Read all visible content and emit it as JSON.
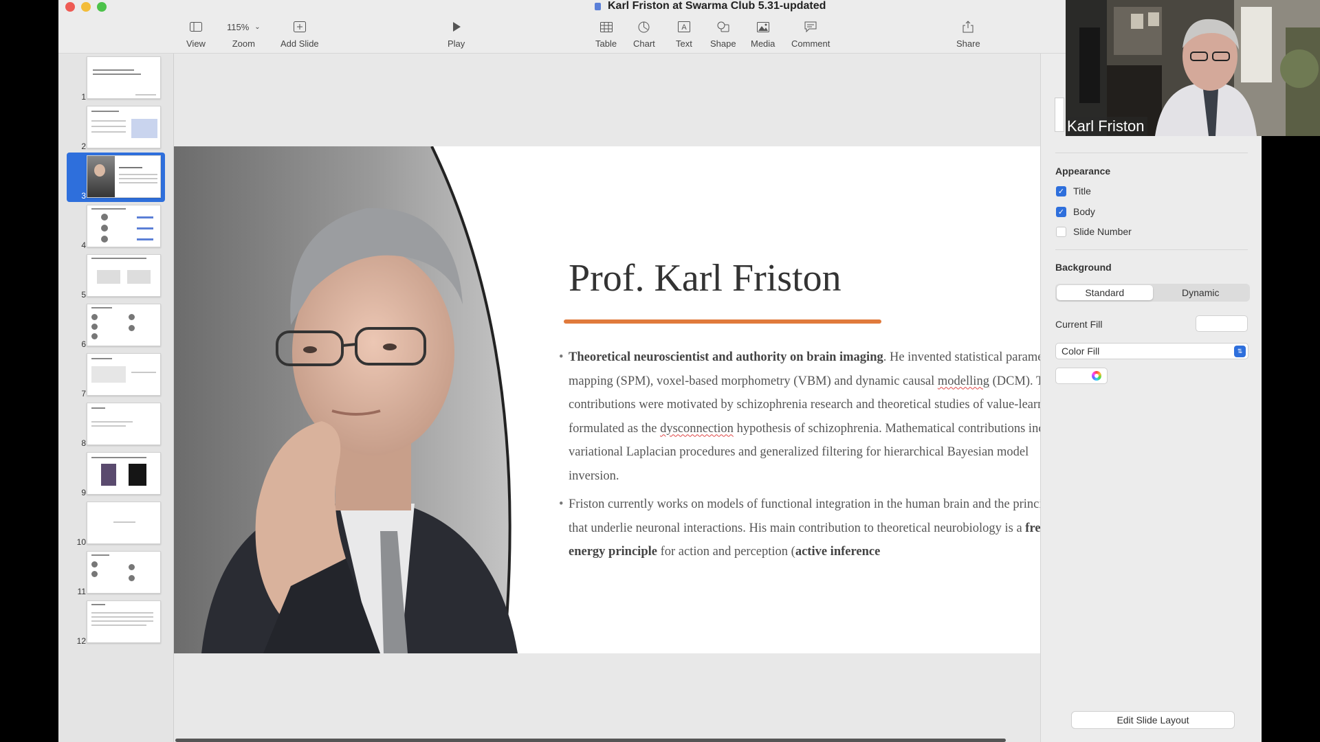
{
  "window": {
    "title": "Karl Friston at Swarma Club 5.31-updated"
  },
  "toolbar": {
    "view_label": "View",
    "zoom_value": "115%",
    "zoom_label": "Zoom",
    "add_slide_label": "Add Slide",
    "play_label": "Play",
    "table_label": "Table",
    "chart_label": "Chart",
    "text_label": "Text",
    "shape_label": "Shape",
    "media_label": "Media",
    "comment_label": "Comment",
    "share_label": "Share"
  },
  "sidebar": {
    "slides": [
      "1",
      "2",
      "3",
      "4",
      "5",
      "6",
      "7",
      "8",
      "9",
      "10",
      "11",
      "12"
    ],
    "selected_slide": "3"
  },
  "slide": {
    "title": "Prof. Karl Friston",
    "bullet1": {
      "bold": "Theoretical neuroscientist and authority on brain imaging",
      "text1": ". He invented statistical parametric mapping (SPM), voxel-based morphometry (VBM) and dynamic causal ",
      "spell1": "modelling",
      "text2": " (DCM). These contributions were motivated by schizophrenia research and theoretical studies of value-learning, formulated as the ",
      "spell2": "dysconnection",
      "text3": " hypothesis of schizophrenia. Mathematical contributions include variational Laplacian procedures and generalized filtering for hierarchical Bayesian model inversion."
    },
    "bullet2": {
      "text1": "Friston currently works on models of functional integration in the human brain and the principles that underlie neuronal interactions. His main contribution to theoretical neurobiology is a ",
      "bold1": "free-energy principle",
      "text2": " for action and perception (",
      "bold2": "active inference"
    }
  },
  "inspector": {
    "appearance_label": "Appearance",
    "title_label": "Title",
    "body_label": "Body",
    "slide_number_label": "Slide Number",
    "background_label": "Background",
    "standard_label": "Standard",
    "dynamic_label": "Dynamic",
    "current_fill_label": "Current Fill",
    "fill_type": "Color Fill",
    "edit_layout_label": "Edit Slide Layout"
  },
  "video": {
    "participant_name": "Karl Friston"
  },
  "colors": {
    "accent": "#2e6fdc",
    "title_underline": "#e07a3c",
    "close": "#ee5b54",
    "minimize": "#f3bd3a",
    "maximize": "#4cc24a"
  }
}
